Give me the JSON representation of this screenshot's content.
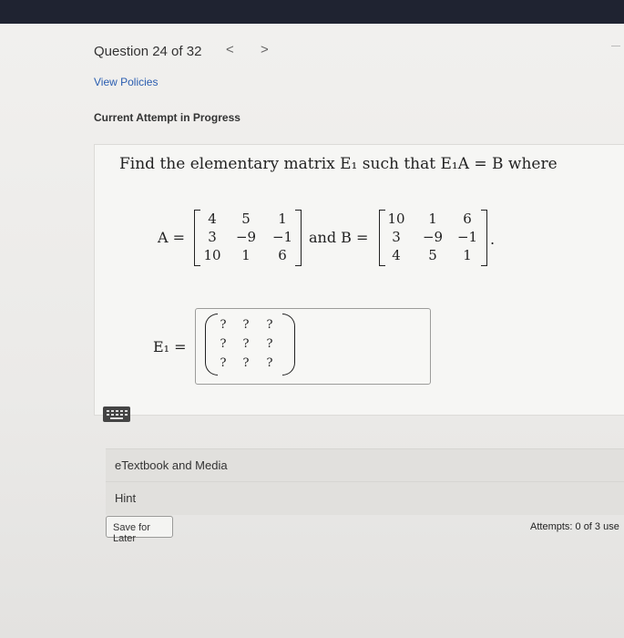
{
  "header": {
    "question_label": "Question 24 of 32",
    "prev_glyph": "<",
    "next_glyph": ">"
  },
  "links": {
    "view_policies": "View Policies"
  },
  "status": {
    "current_attempt": "Current Attempt in Progress"
  },
  "question": {
    "prompt_text": "Find the elementary matrix E₁ such that E₁A = B where",
    "A_label": "A =",
    "and_B_label": "and B =",
    "period": ".",
    "E1_label": "E₁ =",
    "matrix_A": [
      [
        "4",
        "5",
        "1"
      ],
      [
        "3",
        "−9",
        "−1"
      ],
      [
        "10",
        "1",
        "6"
      ]
    ],
    "matrix_B": [
      [
        "10",
        "1",
        "6"
      ],
      [
        "3",
        "−9",
        "−1"
      ],
      [
        "4",
        "5",
        "1"
      ]
    ],
    "answer_cells": [
      [
        "?",
        "?",
        "?"
      ],
      [
        "?",
        "?",
        "?"
      ],
      [
        "?",
        "?",
        "?"
      ]
    ]
  },
  "panels": {
    "etextbook": "eTextbook and Media",
    "hint": "Hint"
  },
  "footer": {
    "save_later": "Save for Later",
    "attempts_text": "Attempts: 0 of 3 use"
  }
}
